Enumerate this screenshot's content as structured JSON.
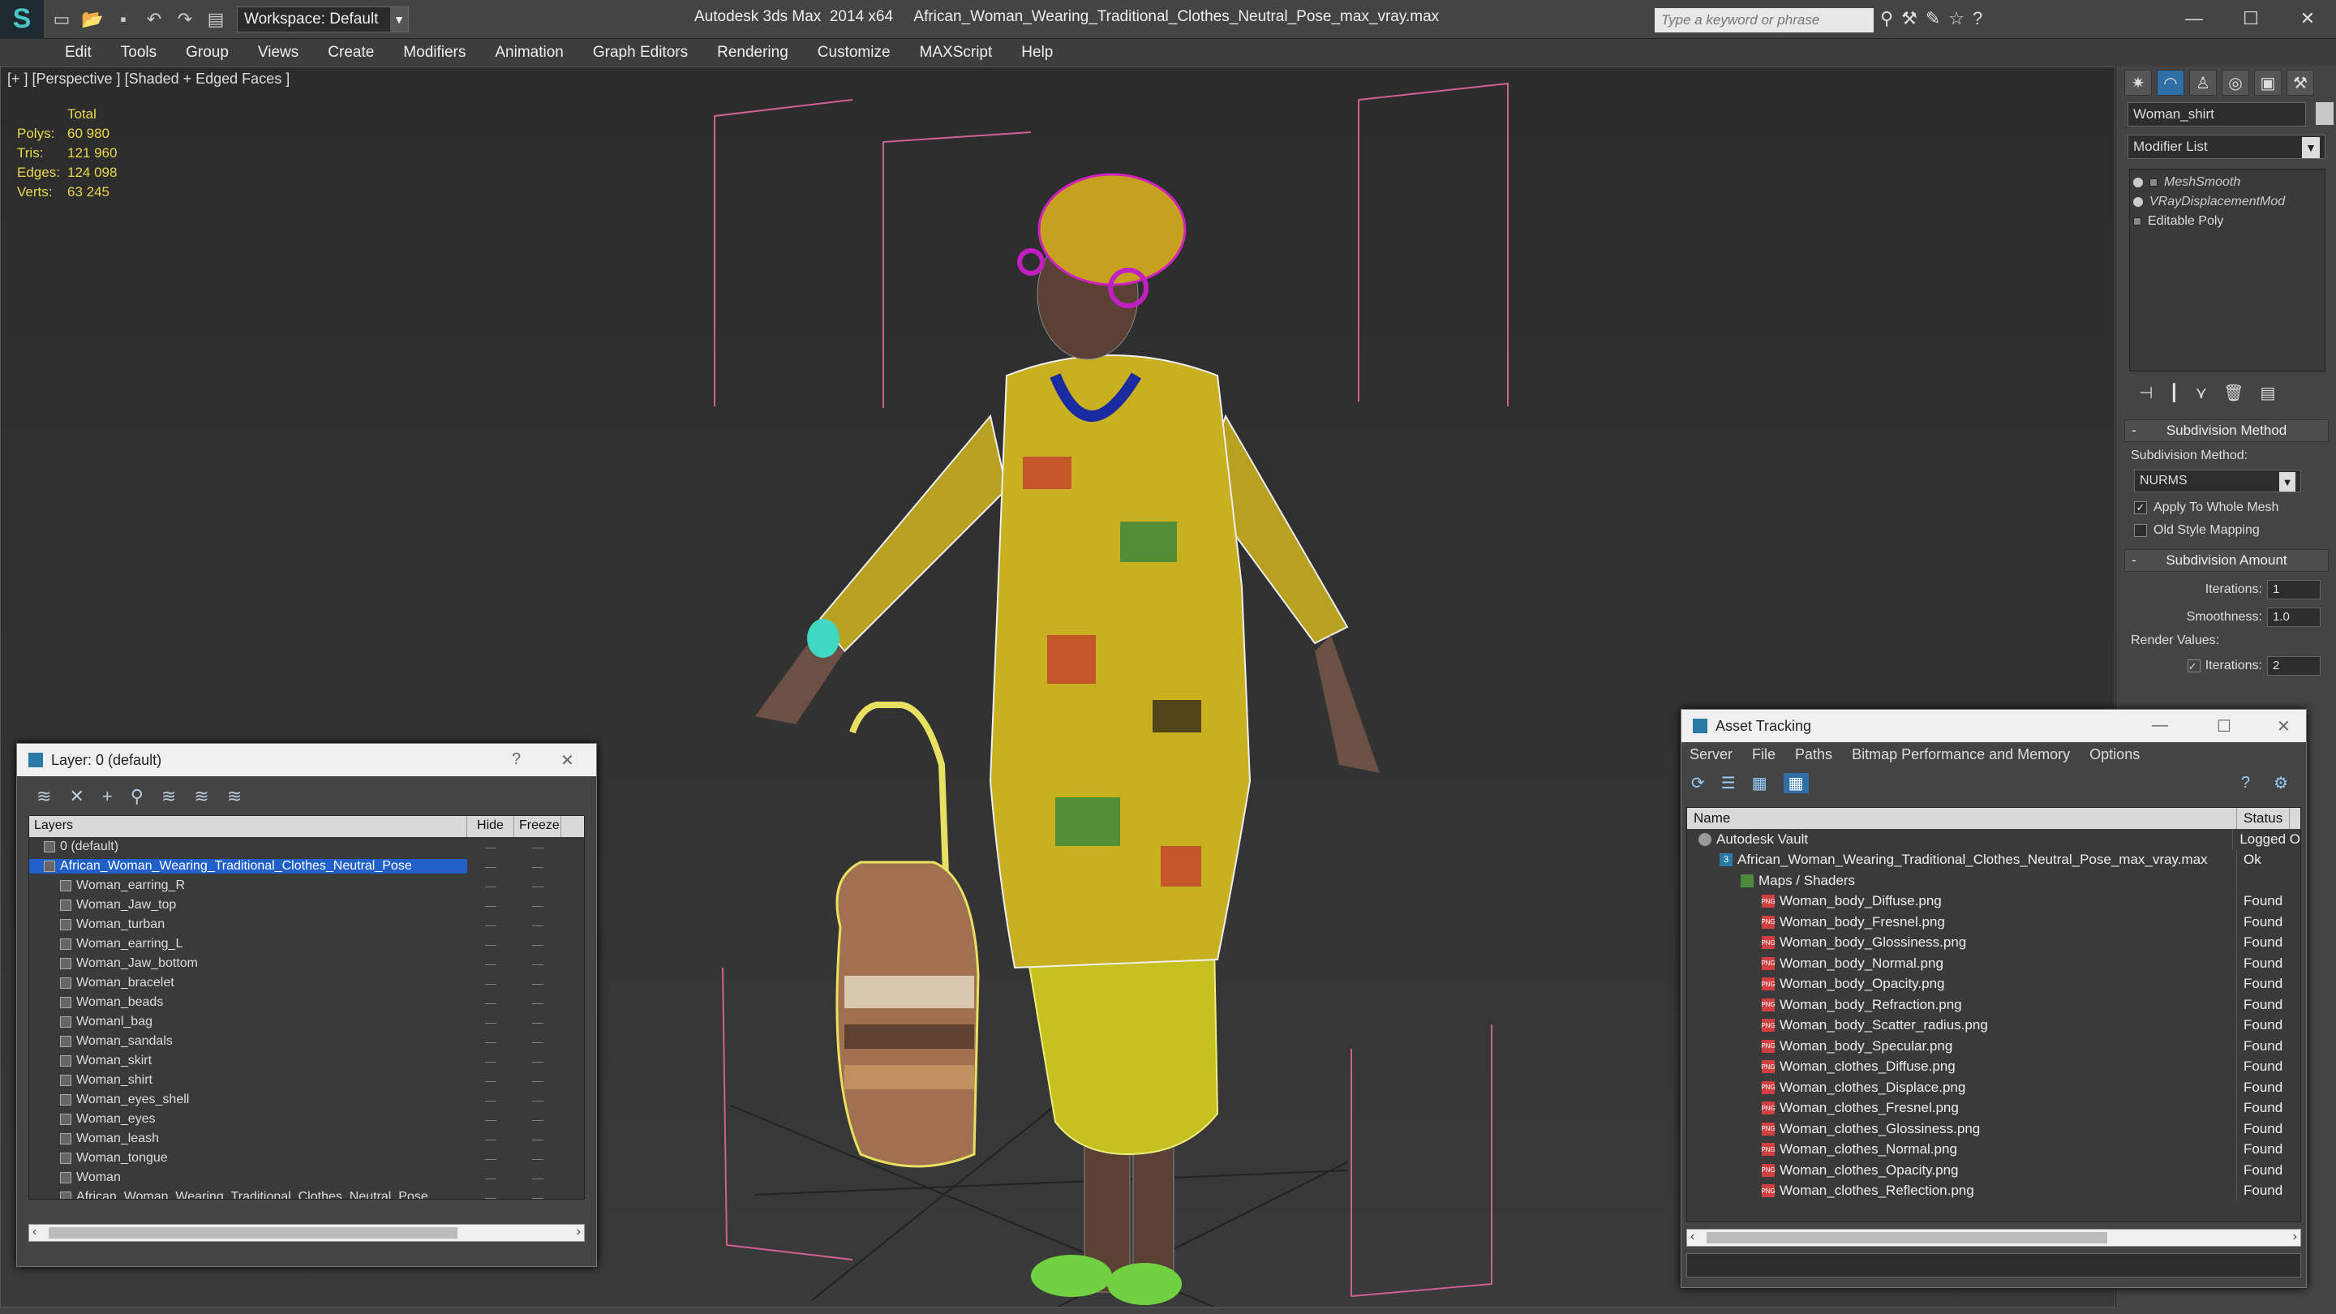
{
  "titlebar": {
    "workspace": "Workspace: Default",
    "app_name": "Autodesk 3ds Max  2014 x64",
    "file_name": "African_Woman_Wearing_Traditional_Clothes_Neutral_Pose_max_vray.max",
    "search_placeholder": "Type a keyword or phrase"
  },
  "menu": [
    "Edit",
    "Tools",
    "Group",
    "Views",
    "Create",
    "Modifiers",
    "Animation",
    "Graph Editors",
    "Rendering",
    "Customize",
    "MAXScript",
    "Help"
  ],
  "viewport": {
    "label": "[+ ] [Perspective ] [Shaded + Edged Faces ]",
    "stats_header": "Total",
    "stats": [
      {
        "k": "Polys:",
        "v": "60 980"
      },
      {
        "k": "Tris:",
        "v": "121 960"
      },
      {
        "k": "Edges:",
        "v": "124 098"
      },
      {
        "k": "Verts:",
        "v": "63 245"
      }
    ]
  },
  "command_panel": {
    "object_name": "Woman_shirt",
    "modifier_list": "Modifier List",
    "stack": [
      {
        "label": "MeshSmooth",
        "style": "italic"
      },
      {
        "label": "VRayDisplacementMod",
        "style": "italic"
      },
      {
        "label": "Editable Poly",
        "style": "normal"
      }
    ],
    "subdivision_method": {
      "title": "Subdivision Method",
      "label": "Subdivision Method:",
      "value": "NURMS",
      "apply_whole_mesh": "Apply To Whole Mesh",
      "old_style": "Old Style Mapping"
    },
    "subdivision_amount": {
      "title": "Subdivision Amount",
      "iterations_label": "Iterations:",
      "iterations": "1",
      "smoothness_label": "Smoothness:",
      "smoothness": "1.0",
      "render_values": "Render Values:",
      "render_iterations_label": "Iterations:",
      "render_iterations": "2"
    }
  },
  "layer_dialog": {
    "title": "Layer: 0 (default)",
    "columns": {
      "layers": "Layers",
      "hide": "Hide",
      "freeze": "Freeze"
    },
    "rows": [
      {
        "name": "0 (default)",
        "level": 1,
        "selected": false
      },
      {
        "name": "African_Woman_Wearing_Traditional_Clothes_Neutral_Pose",
        "level": 1,
        "selected": true
      },
      {
        "name": "Woman_earring_R",
        "level": 2,
        "selected": false
      },
      {
        "name": "Woman_Jaw_top",
        "level": 2,
        "selected": false
      },
      {
        "name": "Woman_turban",
        "level": 2,
        "selected": false
      },
      {
        "name": "Woman_earring_L",
        "level": 2,
        "selected": false
      },
      {
        "name": "Woman_Jaw_bottom",
        "level": 2,
        "selected": false
      },
      {
        "name": "Woman_bracelet",
        "level": 2,
        "selected": false
      },
      {
        "name": "Woman_beads",
        "level": 2,
        "selected": false
      },
      {
        "name": "Womanl_bag",
        "level": 2,
        "selected": false
      },
      {
        "name": "Woman_sandals",
        "level": 2,
        "selected": false
      },
      {
        "name": "Woman_skirt",
        "level": 2,
        "selected": false
      },
      {
        "name": "Woman_shirt",
        "level": 2,
        "selected": false
      },
      {
        "name": "Woman_eyes_shell",
        "level": 2,
        "selected": false
      },
      {
        "name": "Woman_eyes",
        "level": 2,
        "selected": false
      },
      {
        "name": "Woman_leash",
        "level": 2,
        "selected": false
      },
      {
        "name": "Woman_tongue",
        "level": 2,
        "selected": false
      },
      {
        "name": "Woman",
        "level": 2,
        "selected": false
      },
      {
        "name": "African_Woman_Wearing_Traditional_Clothes_Neutral_Pose",
        "level": 2,
        "selected": false
      }
    ]
  },
  "asset_dialog": {
    "title": "Asset Tracking",
    "menu": [
      "Server",
      "File",
      "Paths",
      "Bitmap Performance and Memory",
      "Options"
    ],
    "columns": {
      "name": "Name",
      "status": "Status"
    },
    "rows": [
      {
        "name": "Autodesk Vault",
        "status": "Logged O",
        "level": 0,
        "icon": "vault"
      },
      {
        "name": "African_Woman_Wearing_Traditional_Clothes_Neutral_Pose_max_vray.max",
        "status": "Ok",
        "level": 1,
        "icon": "max"
      },
      {
        "name": "Maps / Shaders",
        "status": "",
        "level": 2,
        "icon": "group"
      },
      {
        "name": "Woman_body_Diffuse.png",
        "status": "Found",
        "level": 3,
        "icon": "png"
      },
      {
        "name": "Woman_body_Fresnel.png",
        "status": "Found",
        "level": 3,
        "icon": "png"
      },
      {
        "name": "Woman_body_Glossiness.png",
        "status": "Found",
        "level": 3,
        "icon": "png"
      },
      {
        "name": "Woman_body_Normal.png",
        "status": "Found",
        "level": 3,
        "icon": "png"
      },
      {
        "name": "Woman_body_Opacity.png",
        "status": "Found",
        "level": 3,
        "icon": "png"
      },
      {
        "name": "Woman_body_Refraction.png",
        "status": "Found",
        "level": 3,
        "icon": "png"
      },
      {
        "name": "Woman_body_Scatter_radius.png",
        "status": "Found",
        "level": 3,
        "icon": "png"
      },
      {
        "name": "Woman_body_Specular.png",
        "status": "Found",
        "level": 3,
        "icon": "png"
      },
      {
        "name": "Woman_clothes_Diffuse.png",
        "status": "Found",
        "level": 3,
        "icon": "png"
      },
      {
        "name": "Woman_clothes_Displace.png",
        "status": "Found",
        "level": 3,
        "icon": "png"
      },
      {
        "name": "Woman_clothes_Fresnel.png",
        "status": "Found",
        "level": 3,
        "icon": "png"
      },
      {
        "name": "Woman_clothes_Glossiness.png",
        "status": "Found",
        "level": 3,
        "icon": "png"
      },
      {
        "name": "Woman_clothes_Normal.png",
        "status": "Found",
        "level": 3,
        "icon": "png"
      },
      {
        "name": "Woman_clothes_Opacity.png",
        "status": "Found",
        "level": 3,
        "icon": "png"
      },
      {
        "name": "Woman_clothes_Reflection.png",
        "status": "Found",
        "level": 3,
        "icon": "png"
      }
    ]
  }
}
